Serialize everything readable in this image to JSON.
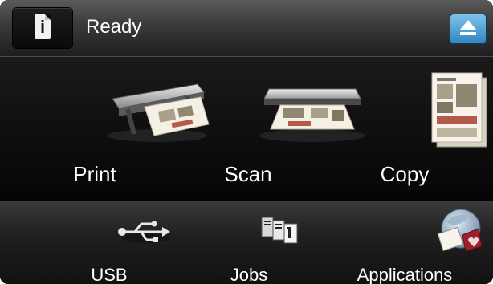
{
  "header": {
    "status": "Ready",
    "info_icon_glyph": "i"
  },
  "main": {
    "tiles": [
      {
        "label": "Print",
        "icon": "printer-icon"
      },
      {
        "label": "Scan",
        "icon": "scanner-icon"
      },
      {
        "label": "Copy",
        "icon": "copy-document-icon"
      }
    ]
  },
  "bottom": {
    "tiles": [
      {
        "label": "USB",
        "icon": "usb-icon"
      },
      {
        "label": "Jobs",
        "icon": "jobs-icon"
      },
      {
        "label": "Applications",
        "icon": "applications-icon"
      }
    ]
  },
  "colors": {
    "background": "#0c0c0c",
    "accent": "#2f86bf"
  }
}
